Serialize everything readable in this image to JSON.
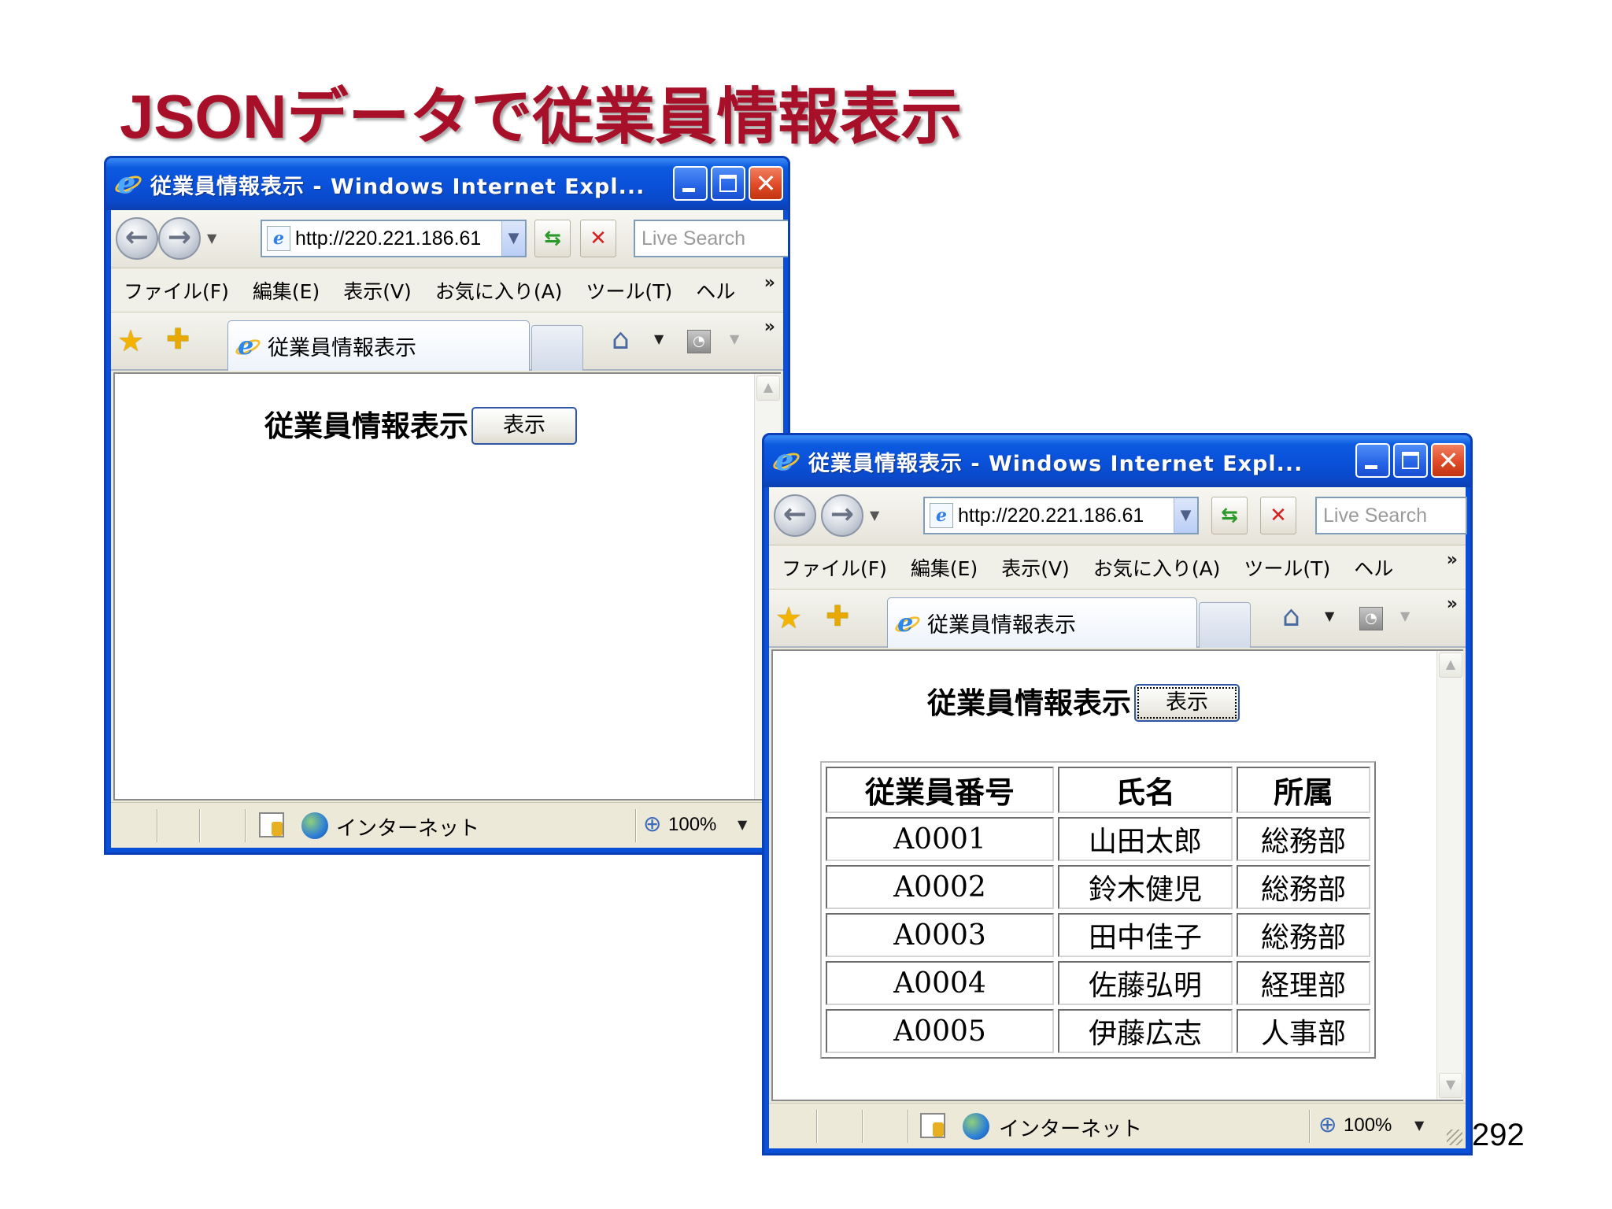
{
  "slide": {
    "title": "JSONデータで従業員情報表示",
    "page_number": "292"
  },
  "browser": {
    "window_title": "従業員情報表示 - Windows Internet Expl...",
    "address": "http://220.221.186.61",
    "search_placeholder": "Live Search",
    "menu": [
      "ファイル(F)",
      "編集(E)",
      "表示(V)",
      "お気に入り(A)",
      "ツール(T)",
      "ヘル"
    ],
    "more_chevron": "»",
    "tab_title": "従業員情報表示",
    "status_zone": "インターネット",
    "zoom": "100%"
  },
  "page": {
    "heading": "従業員情報表示",
    "button_label": "表示"
  },
  "table": {
    "headers": [
      "従業員番号",
      "氏名",
      "所属"
    ],
    "rows": [
      [
        "A0001",
        "山田太郎",
        "総務部"
      ],
      [
        "A0002",
        "鈴木健児",
        "総務部"
      ],
      [
        "A0003",
        "田中佳子",
        "総務部"
      ],
      [
        "A0004",
        "佐藤弘明",
        "経理部"
      ],
      [
        "A0005",
        "伊藤広志",
        "人事部"
      ]
    ]
  }
}
